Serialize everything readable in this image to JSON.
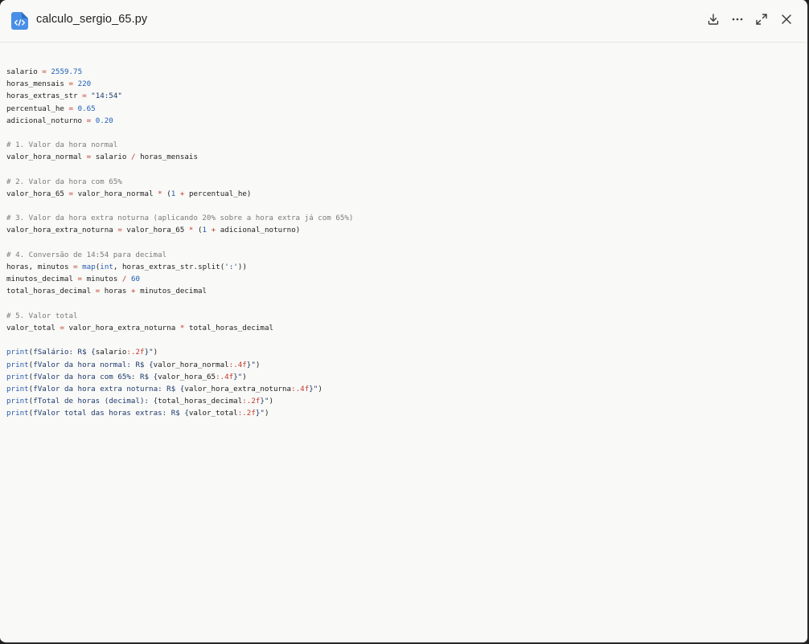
{
  "file": {
    "name": "calculo_sergio_65.py",
    "icon": "code-file-icon",
    "accent": "#4a8fe7"
  },
  "header_actions": [
    {
      "name": "download-icon"
    },
    {
      "name": "more-options-icon"
    },
    {
      "name": "expand-icon"
    },
    {
      "name": "close-icon"
    }
  ],
  "code_lines": [
    "salario = 2559.75",
    "horas_mensais = 220",
    "horas_extras_str = \"14:54\"",
    "percentual_he = 0.65",
    "adicional_noturno = 0.20",
    "",
    "# 1. Valor da hora normal",
    "valor_hora_normal = salario / horas_mensais",
    "",
    "# 2. Valor da hora com 65%",
    "valor_hora_65 = valor_hora_normal * (1 + percentual_he)",
    "",
    "# 3. Valor da hora extra noturna (aplicando 20% sobre a hora extra já com 65%)",
    "valor_hora_extra_noturna = valor_hora_65 * (1 + adicional_noturno)",
    "",
    "# 4. Conversão de 14:54 para decimal",
    "horas, minutos = map(int, horas_extras_str.split(':'))",
    "minutos_decimal = minutos / 60",
    "total_horas_decimal = horas + minutos_decimal",
    "",
    "# 5. Valor total",
    "valor_total = valor_hora_extra_noturna * total_horas_decimal",
    "",
    "print(f\"Salário: R$ {salario:.2f}\")",
    "print(f\"Valor da hora normal: R$ {valor_hora_normal:.4f}\")",
    "print(f\"Valor da hora com 65%: R$ {valor_hora_65:.4f}\")",
    "print(f\"Valor da hora extra noturna: R$ {valor_hora_extra_noturna:.4f}\")",
    "print(f\"Total de horas (decimal): {total_horas_decimal:.2f}\")",
    "print(f\"Valor total das horas extras: R$ {valor_total:.2f}\")"
  ]
}
